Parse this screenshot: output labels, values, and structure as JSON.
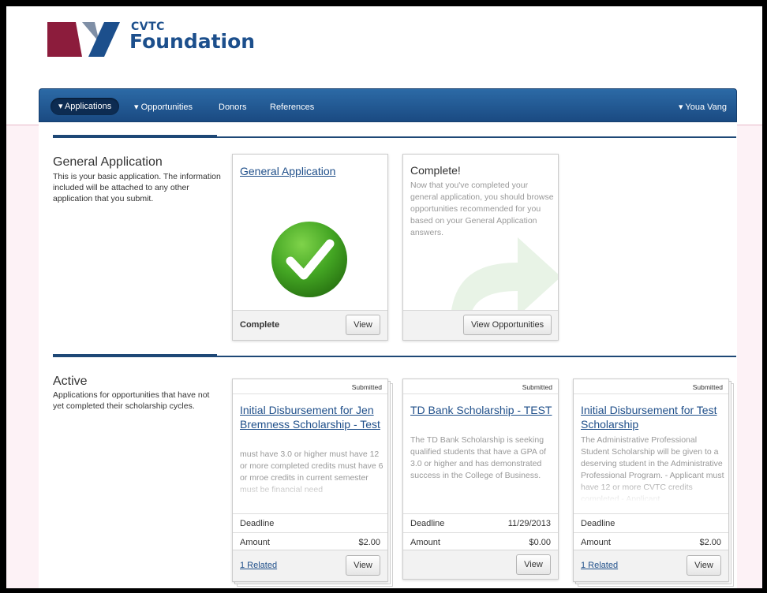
{
  "brand": {
    "small": "CVTC",
    "large": "Foundation"
  },
  "nav": {
    "items": [
      "▾ Applications",
      "▾ Opportunities",
      "Donors",
      "References"
    ],
    "user": "▾ Youa Vang"
  },
  "general": {
    "title": "General Application",
    "desc": "This is your basic application. The information included will be attached to any other application that you submit.",
    "card": {
      "link": "General Application",
      "status": "Complete",
      "button": "View"
    },
    "complete_card": {
      "title": "Complete!",
      "text": "Now that you've completed your general application, you should browse opportunities recommended for you based on your General Application answers.",
      "button": "View Opportunities"
    }
  },
  "active": {
    "title": "Active",
    "desc": "Applications for opportunities that have not yet completed their scholarship cycles.",
    "deadline_label": "Deadline",
    "amount_label": "Amount",
    "cards": [
      {
        "badge": "Submitted",
        "title": "Initial Disbursement for Jen Bremness Scholarship - Test",
        "desc": "must have 3.0 or higher must have 12 or more completed credits must have 6 or mroe credits in current semester must be financial need",
        "deadline": "",
        "amount": "$2.00",
        "related": "1 Related",
        "button": "View"
      },
      {
        "badge": "Submitted",
        "title": "TD Bank Scholarship - TEST",
        "desc": "The TD Bank Scholarship is seeking qualified students that have a GPA of 3.0 or higher and has demonstrated success in the College of Business.",
        "deadline": "11/29/2013",
        "amount": "$0.00",
        "related": "",
        "button": "View"
      },
      {
        "badge": "Submitted",
        "title": "Initial Disbursement for Test Scholarship",
        "desc": "The Administrative Professional Student Scholarship will be given to a deserving student in the Administrative Professional Program. - Applicant must have 12 or more CVTC credits completed - Applicant",
        "deadline": "",
        "amount": "$2.00",
        "related": "1 Related",
        "button": "View"
      }
    ]
  },
  "colors": {
    "nav": "#1a4a82",
    "link": "#1f4f8a",
    "check": "#3a9a22",
    "logo_red": "#8c1c3c",
    "logo_blue": "#1c4f8c"
  },
  "icons": {
    "check": "check-circle-icon",
    "arrow": "curved-arrow-icon"
  }
}
